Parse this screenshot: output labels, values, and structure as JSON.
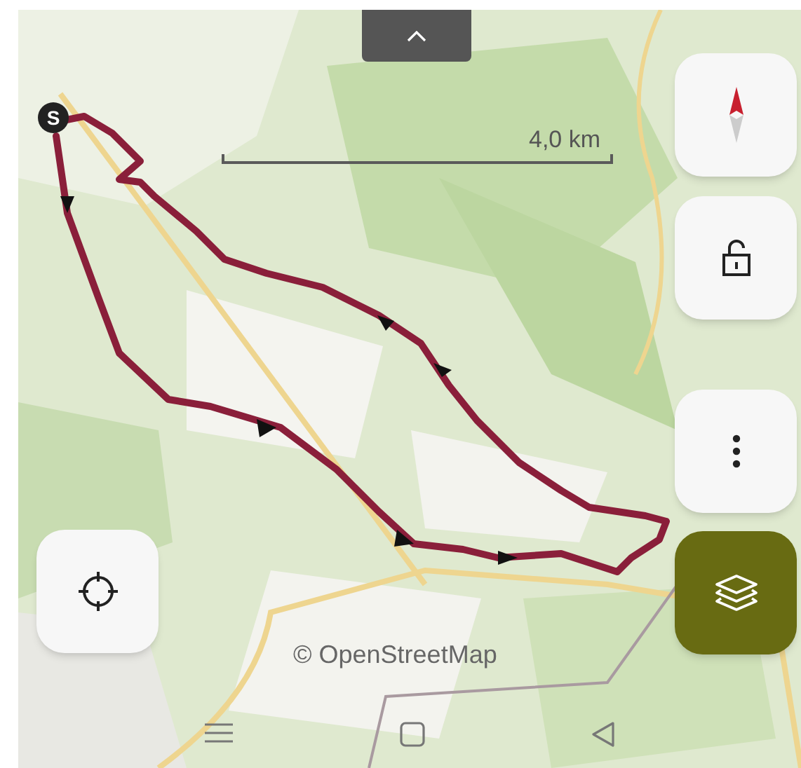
{
  "panel_handle": {
    "expanded": false
  },
  "scale_bar": {
    "label": "4,0 km"
  },
  "route": {
    "start_label": "S"
  },
  "map_buttons": [
    {
      "kind": "compass",
      "selected": false
    },
    {
      "kind": "lock",
      "selected": false
    },
    {
      "kind": "more",
      "selected": false
    },
    {
      "kind": "layers",
      "selected": true
    },
    {
      "kind": "locate",
      "selected": false
    }
  ],
  "attribution": "© OpenStreetMap",
  "nav_bar": [
    {
      "kind": "recents"
    },
    {
      "kind": "home"
    },
    {
      "kind": "back"
    }
  ]
}
